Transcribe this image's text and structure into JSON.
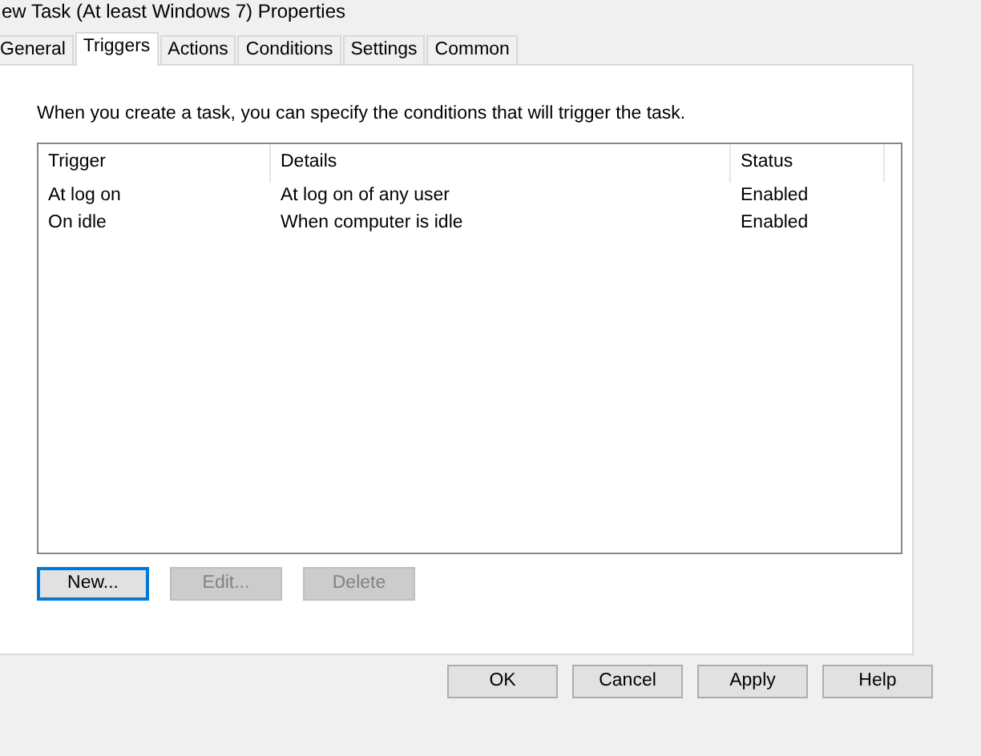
{
  "window": {
    "title": "ew Task (At least Windows 7) Properties"
  },
  "tabs": [
    {
      "label": "General",
      "selected": false
    },
    {
      "label": "Triggers",
      "selected": true
    },
    {
      "label": "Actions",
      "selected": false
    },
    {
      "label": "Conditions",
      "selected": false
    },
    {
      "label": "Settings",
      "selected": false
    },
    {
      "label": "Common",
      "selected": false
    }
  ],
  "description": "When you create a task, you can specify the conditions that will trigger the task.",
  "table": {
    "columns": [
      "Trigger",
      "Details",
      "Status"
    ],
    "rows": [
      [
        "At log on",
        "At log on of any user",
        "Enabled"
      ],
      [
        "On idle",
        "When computer is idle",
        "Enabled"
      ]
    ]
  },
  "list_buttons": [
    {
      "label": "New...",
      "disabled": false
    },
    {
      "label": "Edit...",
      "disabled": true
    },
    {
      "label": "Delete",
      "disabled": true
    }
  ],
  "dialog_buttons": [
    "OK",
    "Cancel",
    "Apply",
    "Help"
  ]
}
